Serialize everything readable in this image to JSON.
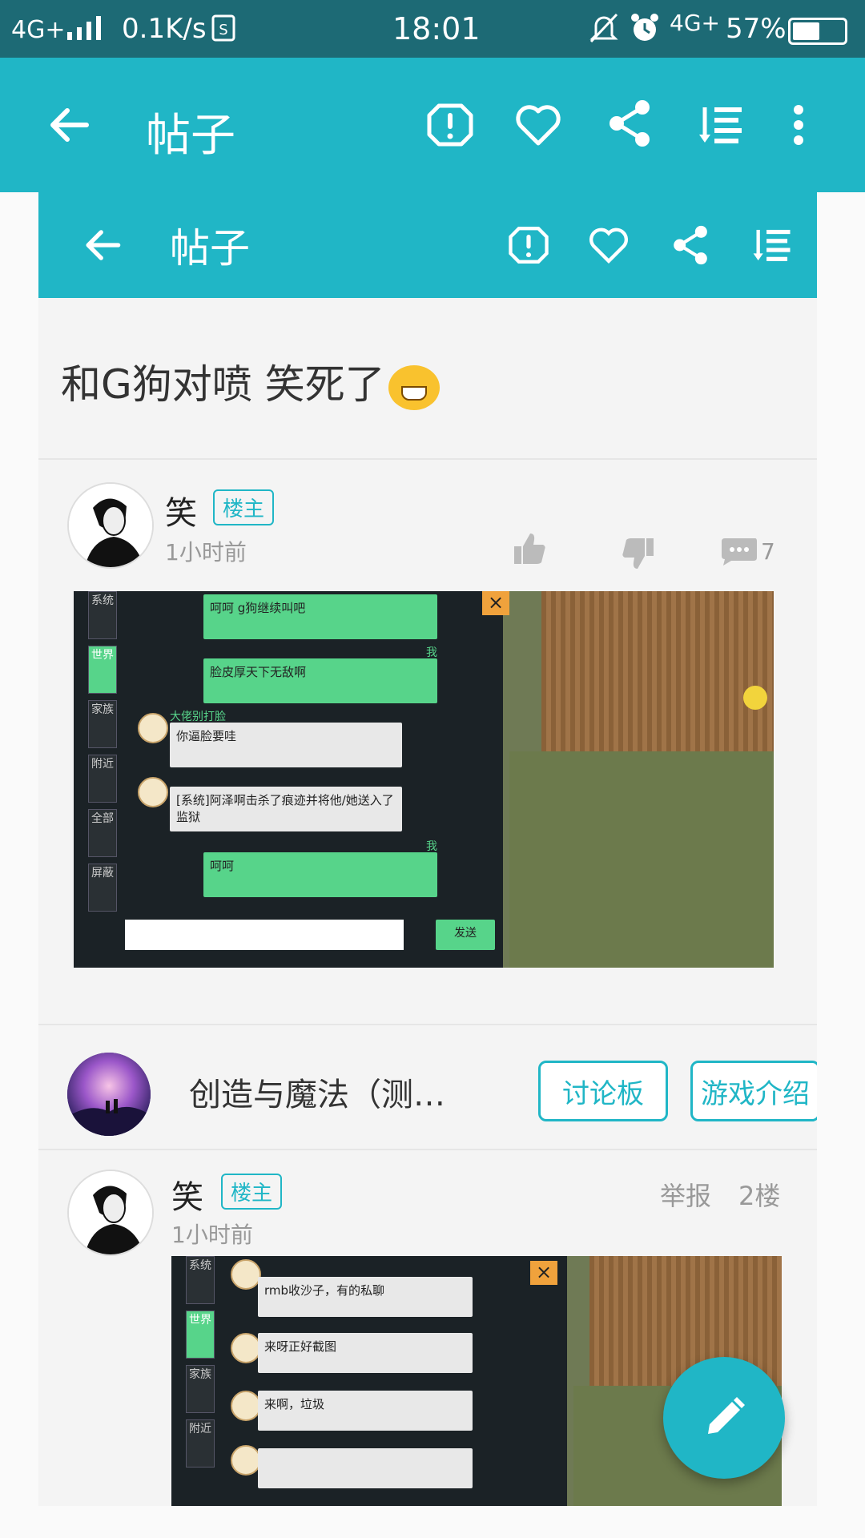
{
  "status_bar": {
    "network": "4G+",
    "speed": "0.1K/s",
    "time": "18:01",
    "network2": "4G+",
    "battery": "57%",
    "battery_level": 0.57
  },
  "app_bar": {
    "title": "帖子"
  },
  "inner_bar": {
    "title": "帖子"
  },
  "post": {
    "title": "和G狗对喷 笑死了"
  },
  "first_post": {
    "author": "笑",
    "badge": "楼主",
    "time": "1小时前",
    "comment_count": "7",
    "screenshot": {
      "tabs": [
        "系统",
        "世界",
        "家族",
        "附近",
        "全部",
        "屏蔽"
      ],
      "me_label": "我",
      "sender_name": "大佬别打脸",
      "messages": [
        "呵呵 g狗继续叫吧",
        "脸皮厚天下无敌啊",
        "你逼脸要哇",
        "[系统]阿泽啊击杀了痕迹并将他/她送入了监狱",
        "呵呵"
      ],
      "send_button": "发送"
    }
  },
  "game_card": {
    "name": "创造与魔法（测…",
    "forum_button": "讨论板",
    "intro_button": "游戏介绍"
  },
  "second_post": {
    "author": "笑",
    "badge": "楼主",
    "time": "1小时前",
    "report": "举报",
    "floor": "2楼",
    "screenshot": {
      "tabs": [
        "系统",
        "世界",
        "家族",
        "附近"
      ],
      "messages": [
        "rmb收沙子，有的私聊",
        "来呀正好截图",
        "来啊，垃圾"
      ]
    }
  },
  "colors": {
    "accent": "#20b6c6",
    "status_bar": "#1d6a75",
    "chat_green": "#57d48a"
  }
}
